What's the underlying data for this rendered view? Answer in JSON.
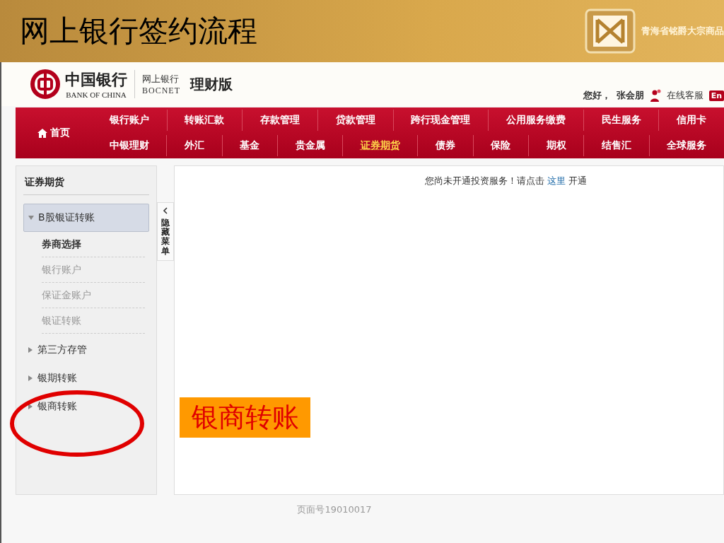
{
  "slide": {
    "title": "网上银行签约流程",
    "logo_text": "青海省铭爵大宗商品"
  },
  "bank_header": {
    "logo_cn": "中国银行",
    "logo_en": "BANK OF CHINA",
    "product": "网上银行",
    "product_en": "BOCNET",
    "edition": "理财版",
    "greeting": "您好，",
    "user": "张会朋",
    "service": "在线客服",
    "language": "En"
  },
  "nav": {
    "home": "首页",
    "upper_items": [
      {
        "label": "银行账户",
        "selected": false
      },
      {
        "label": "转账汇款",
        "selected": false
      },
      {
        "label": "存款管理",
        "selected": false
      },
      {
        "label": "贷款管理",
        "selected": false
      },
      {
        "label": "跨行现金管理",
        "selected": false
      },
      {
        "label": "公用服务缴费",
        "selected": false
      },
      {
        "label": "民生服务",
        "selected": false
      },
      {
        "label": "信用卡",
        "selected": false
      }
    ],
    "lower_items": [
      {
        "label": "中银理财",
        "selected": false
      },
      {
        "label": "外汇",
        "selected": false
      },
      {
        "label": "基金",
        "selected": false
      },
      {
        "label": "贵金属",
        "selected": false
      },
      {
        "label": "证券期货",
        "selected": true
      },
      {
        "label": "债券",
        "selected": false
      },
      {
        "label": "保险",
        "selected": false
      },
      {
        "label": "期权",
        "selected": false
      },
      {
        "label": "结售汇",
        "selected": false
      },
      {
        "label": "全球服务",
        "selected": false
      }
    ]
  },
  "sidebar": {
    "title": "证券期货",
    "hide_tab": "隐藏菜单",
    "groups": [
      {
        "label": "B股银证转账",
        "expanded": true,
        "selected": true,
        "children": [
          {
            "label": "券商选择",
            "selected": true
          },
          {
            "label": "银行账户",
            "selected": false
          },
          {
            "label": "保证金账户",
            "selected": false
          },
          {
            "label": "银证转账",
            "selected": false
          }
        ]
      },
      {
        "label": "第三方存管",
        "expanded": false,
        "selected": false
      },
      {
        "label": "银期转账",
        "expanded": false,
        "selected": false
      },
      {
        "label": "银商转账",
        "expanded": false,
        "selected": false
      }
    ]
  },
  "content": {
    "notice_before": "您尚未开通投资服务！请点击",
    "link": "这里",
    "notice_after": "开通"
  },
  "annotation": {
    "label": "银商转账"
  },
  "footer": {
    "page_number": "页面号19010017"
  }
}
